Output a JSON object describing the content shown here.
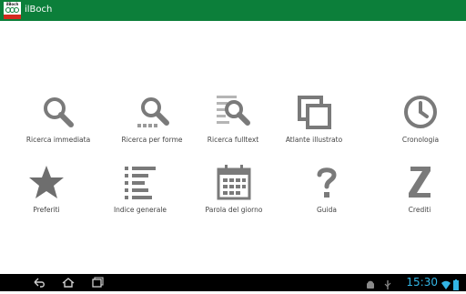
{
  "app": {
    "title": "ilBoch",
    "logo_top": "ilBoch",
    "logo_bottom": "ZANICHELLI"
  },
  "menu": [
    {
      "label": "Ricerca immediata",
      "icon": "search-icon"
    },
    {
      "label": "Ricerca per forme",
      "icon": "search-forms-icon"
    },
    {
      "label": "Ricerca fulltext",
      "icon": "search-fulltext-icon"
    },
    {
      "label": "Atlante illustrato",
      "icon": "gallery-icon"
    },
    {
      "label": "Cronologia",
      "icon": "clock-icon"
    },
    {
      "label": "Preferiti",
      "icon": "star-icon"
    },
    {
      "label": "Indice generale",
      "icon": "list-icon"
    },
    {
      "label": "Parola del giorno",
      "icon": "calendar-icon"
    },
    {
      "label": "Guida",
      "icon": "question-icon"
    },
    {
      "label": "Crediti",
      "icon": "letter-z-icon"
    }
  ],
  "system_bar": {
    "time": "15:30"
  },
  "colors": {
    "action_bar": "#0c7f3a",
    "icon_gray": "#7a7a7a",
    "clock": "#33b5e5"
  }
}
